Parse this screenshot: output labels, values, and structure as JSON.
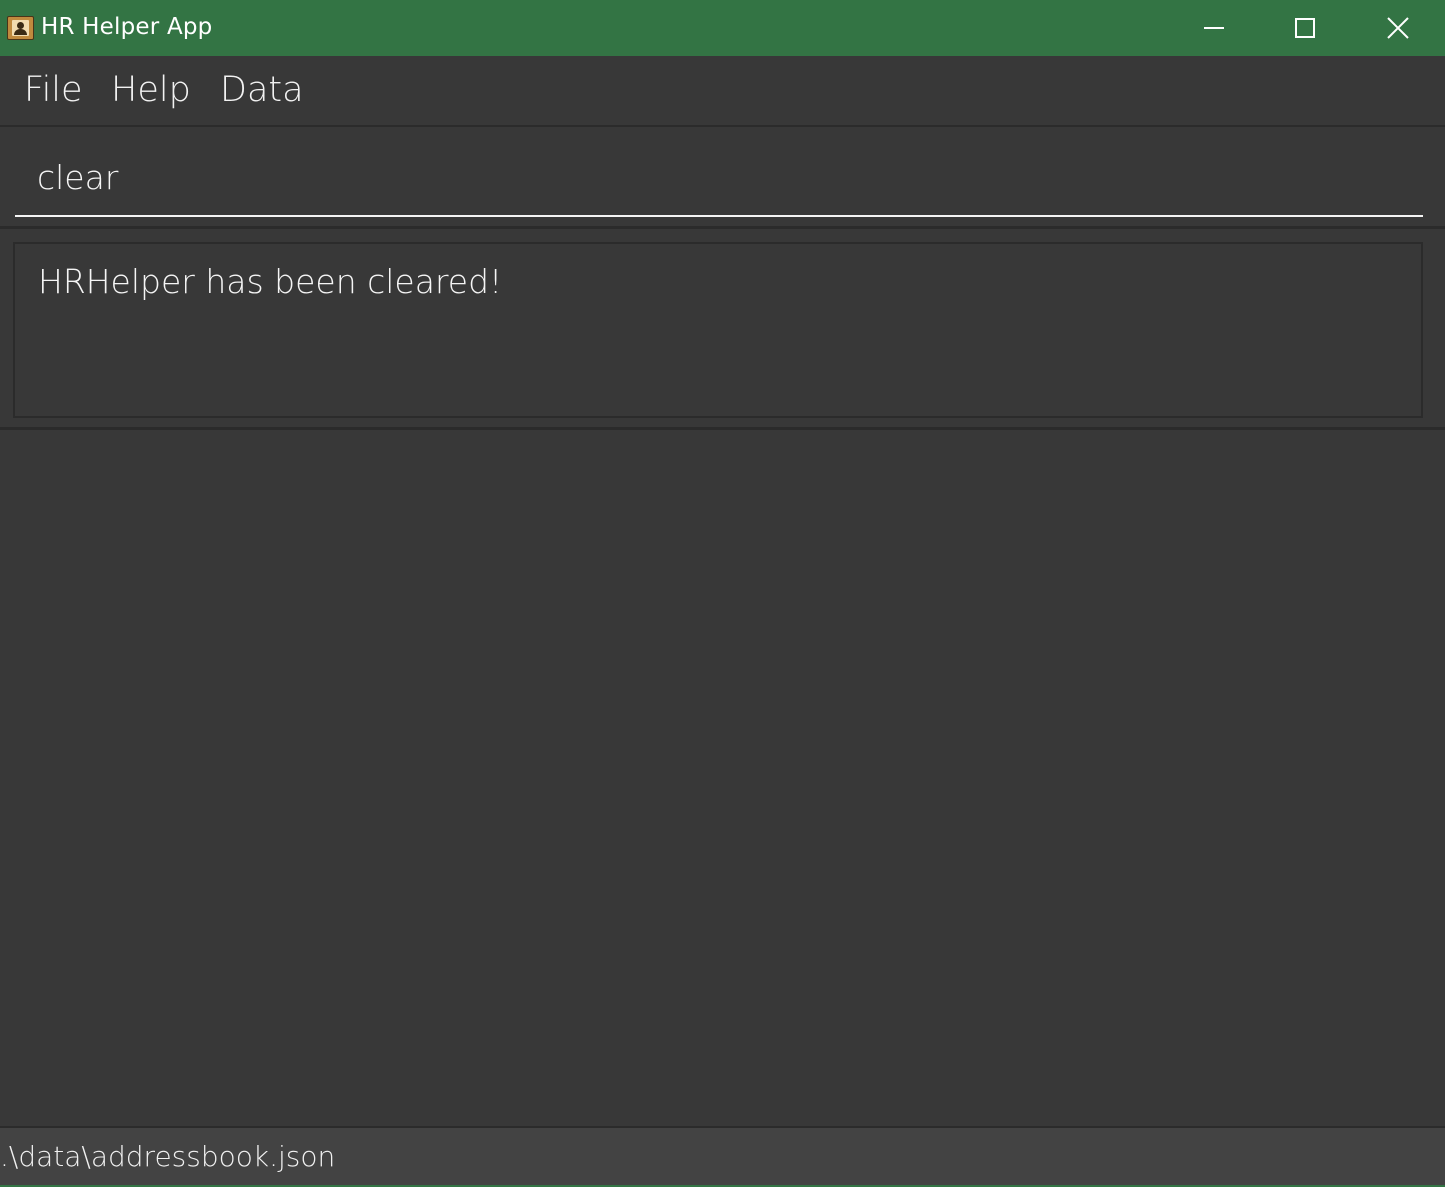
{
  "window": {
    "title": "HR Helper App",
    "title_bar_color": "#337444",
    "controls": [
      "minimize-icon",
      "maximize-icon",
      "close-icon"
    ]
  },
  "menu": {
    "items": [
      {
        "label": "File"
      },
      {
        "label": "Help"
      },
      {
        "label": "Data"
      }
    ]
  },
  "command": {
    "value": "clear"
  },
  "result": {
    "message": "HRHelper has been cleared!"
  },
  "status": {
    "file_path": ".\\data\\addressbook.json"
  },
  "colors": {
    "background": "#383838",
    "statusbar": "#434343",
    "accent": "#337444"
  }
}
